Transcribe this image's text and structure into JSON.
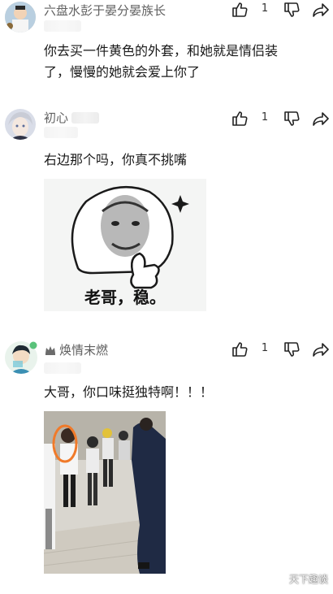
{
  "comments": [
    {
      "username": "六盘水彭于晏分晏族长",
      "likes": "1",
      "text_lines": [
        "你去买一件黄色的外套，和她就是情侣装",
        "了，慢慢的她就会爱上你了"
      ]
    },
    {
      "username": "初心",
      "likes": "1",
      "text_lines": [
        "右边那个吗，你真不挑嘴"
      ],
      "meme_caption": "老哥，稳。"
    },
    {
      "username": "焕情末燃",
      "badge_icon": "crown-icon",
      "likes": "1",
      "text_lines": [
        "大哥，你口味挺独特啊！！！"
      ]
    }
  ],
  "watermark": "天下趣谈",
  "colors": {
    "text": "#1a1a1a",
    "username": "#606060",
    "highlight_circle": "#f07a2a"
  }
}
